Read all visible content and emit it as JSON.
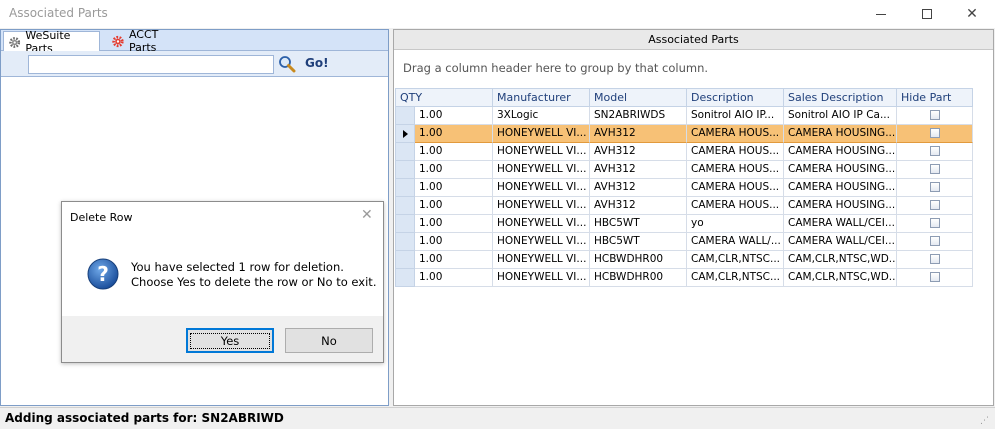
{
  "window": {
    "title": "Associated Parts",
    "minimize_glyph": "",
    "close_glyph": "✕"
  },
  "left": {
    "tabs": [
      {
        "label": "WeSuite Parts",
        "icon": "gear-icon",
        "color": "#6b6b6b"
      },
      {
        "label": "ACCT Parts",
        "icon": "gear-icon",
        "color": "#e53b2e"
      }
    ],
    "search": {
      "value": "",
      "placeholder": ""
    },
    "go_label": "Go!"
  },
  "dialog": {
    "title": "Delete Row",
    "close_glyph": "✕",
    "message_line1": "You have selected 1 row for deletion.",
    "message_line2": "Choose Yes to delete the row or No to exit.",
    "yes_label": "Yes",
    "no_label": "No"
  },
  "right": {
    "header": "Associated Parts",
    "group_hint": "Drag a column header here to group by that column.",
    "columns": [
      "QTY",
      "Manufacturer",
      "Model",
      "Description",
      "Sales Description",
      "Hide Part"
    ],
    "rows": [
      [
        "1.00",
        "3XLogic",
        "SN2ABRIWDS",
        "Sonitrol AIO IP...",
        "Sonitrol AIO IP Ca...",
        false
      ],
      [
        "1.00",
        "HONEYWELL VI...",
        "AVH312",
        "CAMERA HOUS...",
        "CAMERA HOUSING...",
        false
      ],
      [
        "1.00",
        "HONEYWELL VI...",
        "AVH312",
        "CAMERA HOUS...",
        "CAMERA HOUSING...",
        false
      ],
      [
        "1.00",
        "HONEYWELL VI...",
        "AVH312",
        "CAMERA HOUS...",
        "CAMERA HOUSING...",
        false
      ],
      [
        "1.00",
        "HONEYWELL VI...",
        "AVH312",
        "CAMERA HOUS...",
        "CAMERA HOUSING...",
        false
      ],
      [
        "1.00",
        "HONEYWELL VI...",
        "AVH312",
        "CAMERA HOUS...",
        "CAMERA HOUSING...",
        false
      ],
      [
        "1.00",
        "HONEYWELL VI...",
        "HBC5WT",
        "yo",
        "CAMERA WALL/CEI...",
        false
      ],
      [
        "1.00",
        "HONEYWELL VI...",
        "HBC5WT",
        "CAMERA WALL/...",
        "CAMERA WALL/CEI...",
        false
      ],
      [
        "1.00",
        "HONEYWELL VI...",
        "HCBWDHR00",
        "CAM,CLR,NTSC...",
        "CAM,CLR,NTSC,WD...",
        false
      ],
      [
        "1.00",
        "HONEYWELL VI...",
        "HCBWDHR00",
        "CAM,CLR,NTSC...",
        "CAM,CLR,NTSC,WD...",
        false
      ]
    ],
    "selected_row": 1,
    "selected_color": "#f7c176"
  },
  "status": {
    "text": "Adding associated parts for: SN2ABRIWD"
  }
}
